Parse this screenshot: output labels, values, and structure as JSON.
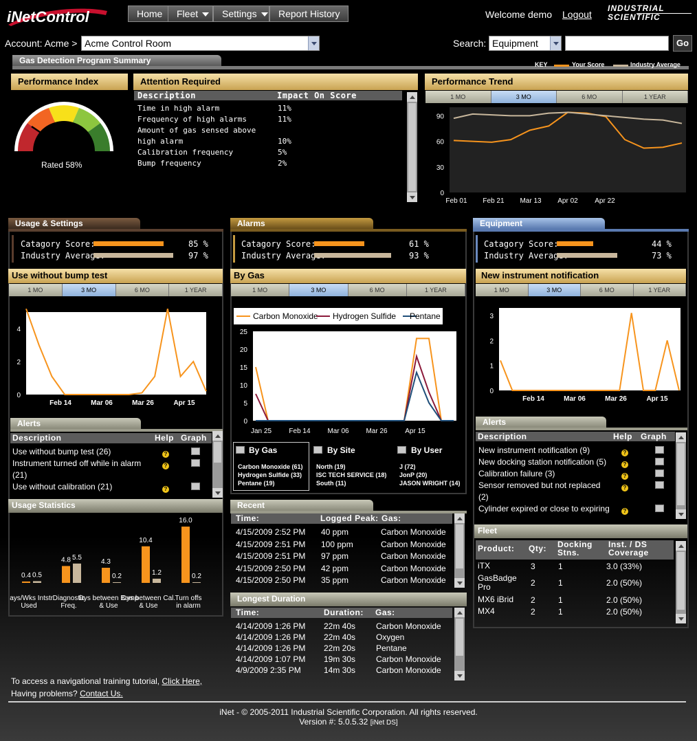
{
  "nav": {
    "logo": "iNetControl",
    "home": "Home",
    "fleet": "Fleet",
    "settings": "Settings",
    "report_history": "Report History",
    "welcome": "Welcome demo",
    "logout": "Logout",
    "brand_line1": "INDUSTRIAL",
    "brand_line2": "SCIENTIFIC"
  },
  "account": {
    "label": "Account: Acme >",
    "value": "Acme Control Room",
    "search_label": "Search:",
    "search_type": "Equipment",
    "search_value": "",
    "go": "Go"
  },
  "summary": {
    "tab": "Gas Detection Program Summary",
    "key": "KEY",
    "your_score": "Your Score",
    "industry_avg": "Industry Average",
    "colors": {
      "your": "#f7941d",
      "industry": "#c8b79c"
    }
  },
  "performance": {
    "title": "Performance Index",
    "rated": "Rated 58%",
    "value": 58
  },
  "attention": {
    "title": "Attention Required",
    "col1": "Description",
    "col2": "Impact On Score",
    "rows": [
      [
        "Time in high alarm",
        "11%"
      ],
      [
        "Frequency of high alarms",
        "11%"
      ],
      [
        "Amount of gas sensed above",
        "",
        ""
      ],
      [
        "   high alarm",
        "10%"
      ],
      [
        "Calibration frequency",
        "5%"
      ],
      [
        "Bump frequency",
        "2%"
      ]
    ]
  },
  "trend": {
    "title": "Performance Trend",
    "tabs": [
      "1 MO",
      "3 MO",
      "6 MO",
      "1 YEAR"
    ]
  },
  "usage": {
    "tab": "Usage & Settings",
    "cat": "Catagory Score:",
    "ind": "Industry Average:",
    "cat_pct": "85 %",
    "ind_pct": "97 %",
    "cat_val": 85,
    "ind_val": 97,
    "chart_title": "Use without bump test",
    "tabs": [
      "1 MO",
      "3 MO",
      "6 MO",
      "1 YEAR"
    ]
  },
  "alarms": {
    "tab": "Alarms",
    "cat": "Catagory Score:",
    "ind": "Industry Average:",
    "cat_pct": "61 %",
    "ind_pct": "93 %",
    "cat_val": 61,
    "ind_val": 93,
    "chart_title": "By Gas",
    "tabs": [
      "1 MO",
      "3 MO",
      "6 MO",
      "1 YEAR"
    ],
    "legend": [
      "Carbon Monoxide",
      "Hydrogen Sulfide",
      "Pentane"
    ],
    "by_gas": "By Gas",
    "by_site": "By Site",
    "by_user": "By User",
    "gas_list": [
      "Carbon Monoxide (61)",
      "Hydrogen Sulfide (33)",
      "Pentane (19)"
    ],
    "site_list": [
      "North (19)",
      "ISC TECH SERVICE (18)",
      "South (11)"
    ],
    "user_list": [
      "J (72)",
      "JonP (20)",
      "JASON WRIGHT (14)"
    ]
  },
  "equipment": {
    "tab": "Equipment",
    "cat": "Catagory Score:",
    "ind": "Industry Average:",
    "cat_pct": "44 %",
    "ind_pct": "73 %",
    "cat_val": 44,
    "ind_val": 73,
    "chart_title": "New instrument notification",
    "tabs": [
      "1 MO",
      "3 MO",
      "6 MO",
      "1 YEAR"
    ]
  },
  "alerts_left": {
    "title": "Alerts",
    "col1": "Description",
    "help": "Help",
    "graph": "Graph",
    "rows": [
      "Use without bump test (26)",
      "Instrument turned off while in alarm",
      "   (21)",
      "Use without calibration (21)"
    ]
  },
  "alerts_right": {
    "title": "Alerts",
    "col1": "Description",
    "help": "Help",
    "graph": "Graph",
    "rows": [
      "New instrument notification (9)",
      "New docking station notification (5)",
      "Calibration failure (3)",
      "Sensor removed but not replaced",
      "   (2)",
      "Cylinder expired or close to expiring"
    ]
  },
  "usage_stats": {
    "title": "Usage Statistics",
    "groups": [
      {
        "label": "Days/Wks Intstr Used",
        "a": 0.4,
        "b": 0.5,
        "la": "0.4",
        "lb": "0.5"
      },
      {
        "label": "Diagnostic Freq.",
        "a": 4.8,
        "b": 5.5,
        "la": "4.8",
        "lb": "5.5"
      },
      {
        "label": "Dys between Bump & Use",
        "a": 4.3,
        "b": 0.2,
        "la": "4.3",
        "lb": "0.2"
      },
      {
        "label": "Dys between Cal. & Use",
        "a": 10.4,
        "b": 1.2,
        "la": "10.4",
        "lb": "1.2"
      },
      {
        "label": "Turn offs in alarm",
        "a": 16.0,
        "b": 0.2,
        "la": "16.0",
        "lb": "0.2"
      }
    ]
  },
  "recent": {
    "title": "Recent",
    "col1": "Time:",
    "col2": "Logged Peak:",
    "col3": "Gas:",
    "rows": [
      [
        "4/15/2009 2:52 PM",
        "40 ppm",
        "Carbon Monoxide"
      ],
      [
        "4/15/2009 2:51 PM",
        "100 ppm",
        "Carbon Monoxide"
      ],
      [
        "4/15/2009 2:51 PM",
        "97 ppm",
        "Carbon Monoxide"
      ],
      [
        "4/15/2009 2:50 PM",
        "42 ppm",
        "Carbon Monoxide"
      ],
      [
        "4/15/2009 2:50 PM",
        "35 ppm",
        "Carbon Monoxide"
      ]
    ]
  },
  "longest": {
    "title": "Longest Duration",
    "col1": "Time:",
    "col2": "Duration:",
    "col3": "Gas:",
    "rows": [
      [
        "4/14/2009 1:26 PM",
        "22m 40s",
        "Carbon Monoxide"
      ],
      [
        "4/14/2009 1:26 PM",
        "22m 40s",
        "Oxygen"
      ],
      [
        "4/14/2009 1:26 PM",
        "22m 20s",
        "Pentane"
      ],
      [
        "4/14/2009 1:07 PM",
        "19m 30s",
        "Carbon Monoxide"
      ],
      [
        "4/9/2009 2:35 PM",
        "14m 30s",
        "Carbon Monoxide"
      ]
    ]
  },
  "fleet": {
    "title": "Fleet",
    "col1": "Product:",
    "col2": "Qty:",
    "col3": "Docking Stns.",
    "col4": "Inst. / DS Coverage",
    "rows": [
      [
        "iTX",
        "3",
        "1",
        "3.0 (33%)"
      ],
      [
        "GasBadge Pro",
        "2",
        "1",
        "2.0 (50%)"
      ],
      [
        "MX6 iBrid",
        "2",
        "1",
        "2.0 (50%)"
      ],
      [
        "MX4",
        "2",
        "1",
        "2.0 (50%)"
      ]
    ]
  },
  "footer": {
    "tutorial": "To access a navigational training tutorial,",
    "click_here": "Click Here,",
    "problems": "Having problems?",
    "contact": "Contact Us.",
    "copyright": "iNet -  © 2005-2011 Industrial Scientific Corporation. All rights reserved.",
    "version": "Version #: 5.0.5.32",
    "version_tag": "[iNet DS]"
  },
  "chart_data": [
    {
      "type": "line",
      "title": "Performance Trend",
      "categories": [
        "Feb 01",
        "Feb 21",
        "Mar 13",
        "Apr 02",
        "Apr 22"
      ],
      "ylim": [
        0,
        100
      ],
      "yticks": [
        0,
        30,
        60,
        90
      ],
      "series": [
        {
          "name": "Your Score",
          "x": [
            0,
            1,
            2,
            3,
            4,
            5,
            6,
            7,
            8,
            9,
            10,
            11,
            12
          ],
          "values": [
            61,
            60,
            59,
            62,
            73,
            78,
            94,
            93,
            89,
            62,
            52,
            53,
            58
          ]
        },
        {
          "name": "Industry Average",
          "x": [
            0,
            1,
            2,
            3,
            4,
            5,
            6,
            7,
            8,
            9,
            10,
            11,
            12
          ],
          "values": [
            87,
            92,
            91,
            90,
            90,
            93,
            94,
            92,
            90,
            88,
            86,
            85,
            81
          ]
        }
      ]
    },
    {
      "type": "line",
      "title": "Use without bump test",
      "categories": [
        "Feb 14",
        "Mar 06",
        "Mar 26",
        "Apr 15"
      ],
      "ylim": [
        0,
        5
      ],
      "yticks": [
        0,
        2,
        4
      ],
      "series": [
        {
          "name": "",
          "values": [
            5.2,
            3,
            1.1,
            0,
            0,
            0,
            0,
            0,
            0,
            0.1,
            1.1,
            5.2,
            1.1,
            2,
            0.2
          ]
        }
      ]
    },
    {
      "type": "line",
      "title": "By Gas",
      "categories": [
        "Jan 25",
        "Feb 14",
        "Mar 06",
        "Mar 26",
        "Apr 15"
      ],
      "ylim": [
        0,
        25
      ],
      "yticks": [
        0,
        5,
        10,
        15,
        20,
        25
      ],
      "series": [
        {
          "name": "Carbon Monoxide",
          "values": [
            15,
            0,
            0,
            0,
            0,
            0,
            0,
            0,
            0,
            0,
            0,
            0,
            0,
            23,
            23,
            0,
            0
          ]
        },
        {
          "name": "Hydrogen Sulfide",
          "values": [
            7.5,
            0,
            0,
            0,
            0,
            0,
            0,
            0,
            0,
            0,
            0,
            0,
            0,
            18,
            8,
            0,
            0
          ]
        },
        {
          "name": "Pentane",
          "values": [
            0,
            0,
            0,
            0,
            0,
            0,
            0,
            0,
            0,
            0,
            0,
            0,
            0,
            13.5,
            5,
            0,
            0
          ]
        }
      ]
    },
    {
      "type": "line",
      "title": "New instrument notification",
      "categories": [
        "Feb 14",
        "Mar 06",
        "Mar 26",
        "Apr 15"
      ],
      "ylim": [
        0,
        3.3
      ],
      "yticks": [
        0,
        1,
        2,
        3
      ],
      "series": [
        {
          "name": "",
          "values": [
            1.2,
            0,
            0,
            0,
            0,
            0,
            0,
            0,
            0,
            0,
            0,
            3.1,
            0,
            0,
            2,
            0
          ]
        }
      ]
    },
    {
      "type": "bar",
      "title": "Usage Statistics",
      "categories": [
        "Days/Wks Intstr Used",
        "Diagnostic Freq.",
        "Dys between Bump & Use",
        "Dys between Cal. & Use",
        "Turn offs in alarm"
      ],
      "series": [
        {
          "name": "Your Score",
          "values": [
            0.4,
            4.8,
            4.3,
            10.4,
            16.0
          ]
        },
        {
          "name": "Industry Average",
          "values": [
            0.5,
            5.5,
            0.2,
            1.2,
            0.2
          ]
        }
      ]
    }
  ]
}
